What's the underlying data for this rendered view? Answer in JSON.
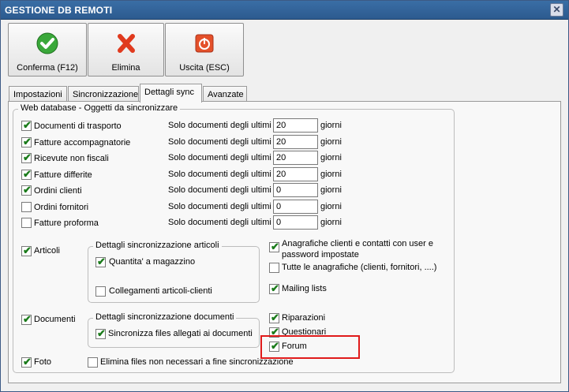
{
  "window": {
    "title": "GESTIONE DB REMOTI",
    "close_glyph": "✕"
  },
  "toolbar": {
    "confirm_label": "Conferma (F12)",
    "delete_label": "Elimina",
    "exit_label": "Uscita (ESC)"
  },
  "tabs": [
    {
      "label": "Impostazioni"
    },
    {
      "label": "Sincronizzazione"
    },
    {
      "label": "Dettagli sync"
    },
    {
      "label": "Avanzate"
    }
  ],
  "active_tab": "Dettagli sync",
  "group_title": "Web database - Oggetti da sincronizzare",
  "docs": [
    {
      "label": "Documenti di trasporto",
      "checked": true,
      "prefix": "Solo documenti degli ultimi",
      "value": "20",
      "suffix": "giorni"
    },
    {
      "label": "Fatture accompagnatorie",
      "checked": true,
      "prefix": "Solo documenti degli ultimi",
      "value": "20",
      "suffix": "giorni"
    },
    {
      "label": "Ricevute non fiscali",
      "checked": true,
      "prefix": "Solo documenti degli ultimi",
      "value": "20",
      "suffix": "giorni"
    },
    {
      "label": "Fatture differite",
      "checked": true,
      "prefix": "Solo documenti degli ultimi",
      "value": "20",
      "suffix": "giorni"
    },
    {
      "label": "Ordini clienti",
      "checked": true,
      "prefix": "Solo documenti degli ultimi",
      "value": "0",
      "suffix": "giorni"
    },
    {
      "label": "Ordini fornitori",
      "checked": false,
      "prefix": "Solo documenti degli ultimi",
      "value": "0",
      "suffix": "giorni"
    },
    {
      "label": "Fatture proforma",
      "checked": false,
      "prefix": "Solo documenti degli ultimi",
      "value": "0",
      "suffix": "giorni"
    }
  ],
  "articoli": {
    "label": "Articoli",
    "checked": true,
    "group_title": "Dettagli sincronizzazione articoli",
    "qty_label": "Quantita' a magazzino",
    "qty_checked": true,
    "links_label": "Collegamenti articoli-clienti",
    "links_checked": false
  },
  "documenti": {
    "label": "Documenti",
    "checked": true,
    "group_title": "Dettagli sincronizzazione documenti",
    "attach_label": "Sincronizza files allegati ai documenti",
    "attach_checked": true
  },
  "foto": {
    "label": "Foto",
    "checked": true,
    "delete_label": "Elimina files non necessari a fine sincronizzazione",
    "delete_checked": false
  },
  "right_options": {
    "anagrafiche_user": "Anagrafiche clienti e contatti con user e password impostate",
    "anagrafiche_user_checked": true,
    "anagrafiche_all": "Tutte le anagrafiche (clienti, fornitori, ....)",
    "anagrafiche_all_checked": false,
    "mailing": "Mailing lists",
    "mailing_checked": true,
    "riparazioni": "Riparazioni",
    "riparazioni_checked": true,
    "questionari": "Questionari",
    "questionari_checked": true,
    "forum": "Forum",
    "forum_checked": true
  },
  "check_glyph": "✔",
  "colors": {
    "title_bar": "#2c5a8f",
    "highlight": "#e01b1b",
    "check": "#1b7b1b"
  }
}
